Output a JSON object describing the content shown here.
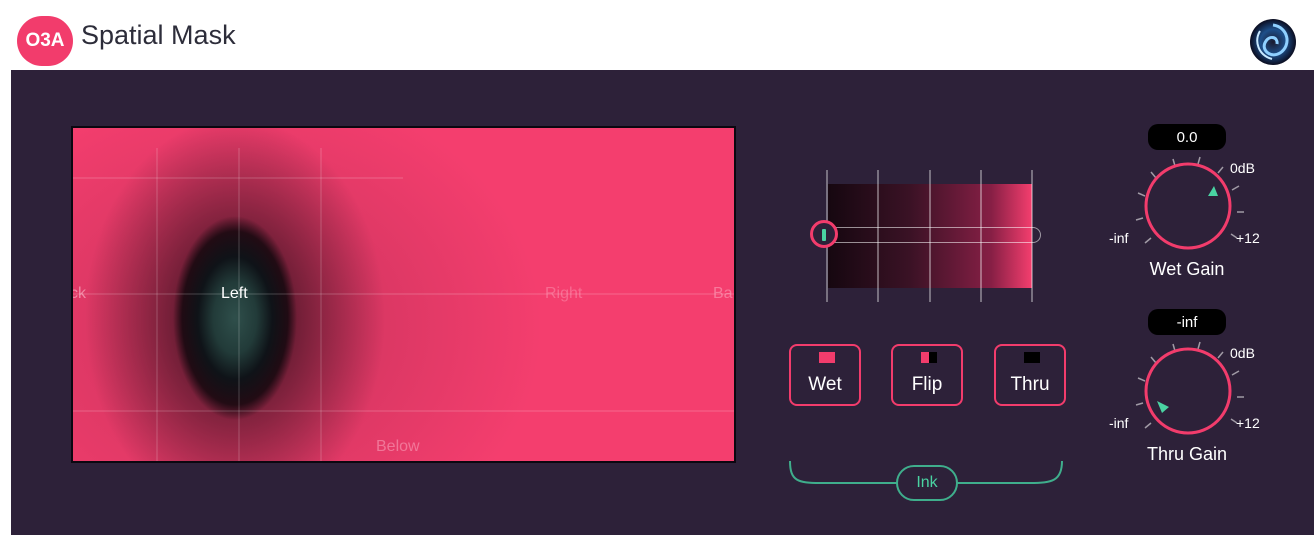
{
  "header": {
    "badge": "O3A",
    "title": "Spatial Mask",
    "logo_icon": "spiral-logo-icon"
  },
  "colors": {
    "accent": "#f23c6c",
    "panel": "#2d2139",
    "teal": "#4ad3a2"
  },
  "map": {
    "labels": {
      "left": "Left",
      "back": "ck",
      "below": "Below",
      "right": "Right",
      "back_right": "Ba"
    }
  },
  "ink": {
    "strength_level": 0.0,
    "buttons": [
      {
        "label": "Wet",
        "icon": "wet-swatch-icon"
      },
      {
        "label": "Flip",
        "icon": "flip-swatch-icon"
      },
      {
        "label": "Thru",
        "icon": "thru-swatch-icon"
      }
    ],
    "group_label": "Ink"
  },
  "wet_gain": {
    "value": "0.0",
    "label": "Wet Gain",
    "min_label": "-inf",
    "max_label": "+12",
    "unity_label": "0dB"
  },
  "thru_gain": {
    "value": "-inf",
    "label": "Thru Gain",
    "min_label": "-inf",
    "max_label": "+12",
    "unity_label": "0dB"
  }
}
